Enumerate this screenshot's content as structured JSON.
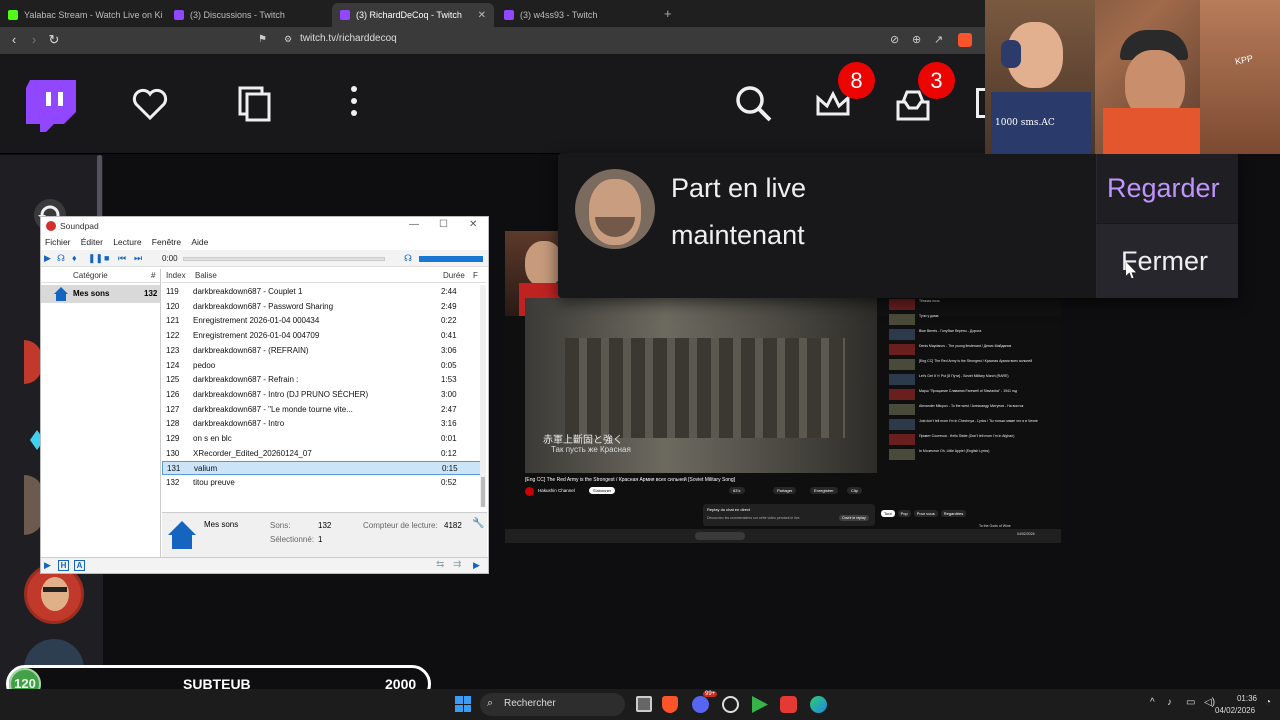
{
  "browser": {
    "tabs": [
      {
        "title": "Yalabac Stream - Watch Live on Kick",
        "favicon_color": "#53fc18",
        "active": false
      },
      {
        "title": "(3) Discussions - Twitch",
        "favicon_color": "#9146ff",
        "active": false
      },
      {
        "title": "(3) RichardDeCoq - Twitch",
        "favicon_color": "#9146ff",
        "active": true
      },
      {
        "title": "(3) w4ss93 - Twitch",
        "favicon_color": "#9146ff",
        "active": false
      }
    ],
    "url": "twitch.tv/richarddecoq"
  },
  "twitch_nav": {
    "notifications_count": "8",
    "inbox_count": "3"
  },
  "notification": {
    "line1": "Part en live",
    "line2": "maintenant",
    "watch_label": "Regarder",
    "close_label": "Fermer"
  },
  "soundpad": {
    "title": "Soundpad",
    "menu": [
      "Fichier",
      "Éditer",
      "Lecture",
      "Fenêtre",
      "Aide"
    ],
    "time": "0:00",
    "cat_header": {
      "name": "Catégorie",
      "count": "#"
    },
    "category": {
      "name": "Mes sons",
      "count": "132"
    },
    "list_header": {
      "index": "Index",
      "tag": "Balise",
      "duration": "Durée",
      "extra": "F"
    },
    "rows": [
      {
        "index": "119",
        "tag": "darkbreakdown687 - Couplet 1",
        "duration": "2:44"
      },
      {
        "index": "120",
        "tag": "darkbreakdown687 - Password Sharing",
        "duration": "2:49"
      },
      {
        "index": "121",
        "tag": "Enregistrement 2026-01-04 000434",
        "duration": "0:22"
      },
      {
        "index": "122",
        "tag": "Enregistrement 2026-01-04 004709",
        "duration": "0:41"
      },
      {
        "index": "123",
        "tag": "darkbreakdown687 - (REFRAIN)",
        "duration": "3:06"
      },
      {
        "index": "124",
        "tag": "pedoo",
        "duration": "0:05"
      },
      {
        "index": "125",
        "tag": "darkbreakdown687 - Refrain :",
        "duration": "1:53"
      },
      {
        "index": "126",
        "tag": "darkbreakdown687 - Intro (DJ PRUNO SÉCHER)",
        "duration": "3:00"
      },
      {
        "index": "127",
        "tag": "darkbreakdown687 - \"Le monde tourne vite...",
        "duration": "2:47"
      },
      {
        "index": "128",
        "tag": "darkbreakdown687 - Intro",
        "duration": "3:16"
      },
      {
        "index": "129",
        "tag": "on s en blc",
        "duration": "0:01"
      },
      {
        "index": "130",
        "tag": "XRecorder_Edited_20260124_07",
        "duration": "0:12"
      },
      {
        "index": "131",
        "tag": "valium",
        "duration": "0:15"
      },
      {
        "index": "132",
        "tag": "titou preuve",
        "duration": "0:52"
      }
    ],
    "selected_index": "131",
    "info": {
      "name": "Mes sons",
      "sons_label": "Sons:",
      "sons_value": "132",
      "selected_label": "Sélectionné:",
      "selected_value": "1",
      "counter_label": "Compteur de lecture:",
      "counter_value": "4182"
    }
  },
  "video": {
    "subtitle_line1": "赤軍上斷固と強く",
    "subtitle_line2": "Так пусть же Красная",
    "video_title": "[Eng CC] The Red Army is the Strongest / Красная Армия всех сильней [Soviet Military Song]",
    "channel": "Hakushin Channel",
    "subscribe": "S'abonner",
    "likes": "63 k",
    "share": "Partager",
    "download": "Enregistrer",
    "clip": "Clip",
    "chat_replay": "Replay du chat en direct",
    "chat_note": "Découvrez les commentaires sur cette vidéo pendant le live.",
    "chat_button": "Ouvrir le replay",
    "chips": [
      "Tout",
      "Pop",
      "Pour vous",
      "Regardées"
    ],
    "recommendations": [
      "Тёмная ночь",
      "Тучи у дома",
      "Blue Berets - Голубые береты - Дорога",
      "Denis Maydanov - The young lieutenant / Денис Майданов",
      "[Eng CC] The Red Army is the Strongest / Красная Армия всех сильней",
      "Let's Get It 'n' Put [8 Пути] - Soviet Military March (RARE)",
      "Марш \"Прощание Славянки Farewell of Slavianka\" - 1941 год",
      "Alexander Mitupov - To the west / Александр Митупов - На восток",
      "Just don't tell mom I'm in Chechnya - Lyrics / Ты только маме что я в Чечне",
      "Привет Соотечки - Hello Sister (Don't tell mom I'm in Afghan)",
      "In Мочечное Oh, Little Apple! (English Lyrics)"
    ],
    "recommendation_extra": "To the Gods of Wine",
    "taskbar_date": "04/02/2026"
  },
  "subgoal": {
    "current": "120",
    "label": "SUBTEUB",
    "target": "2000",
    "progress_fraction": 0.06
  },
  "webcam": {
    "shirt_text": "1000 sms.AC",
    "tag_text": "KPP"
  },
  "taskbar": {
    "search_placeholder": "Rechercher",
    "time": "01:36",
    "date": "04/02/2026",
    "messenger_badge": "99+"
  }
}
